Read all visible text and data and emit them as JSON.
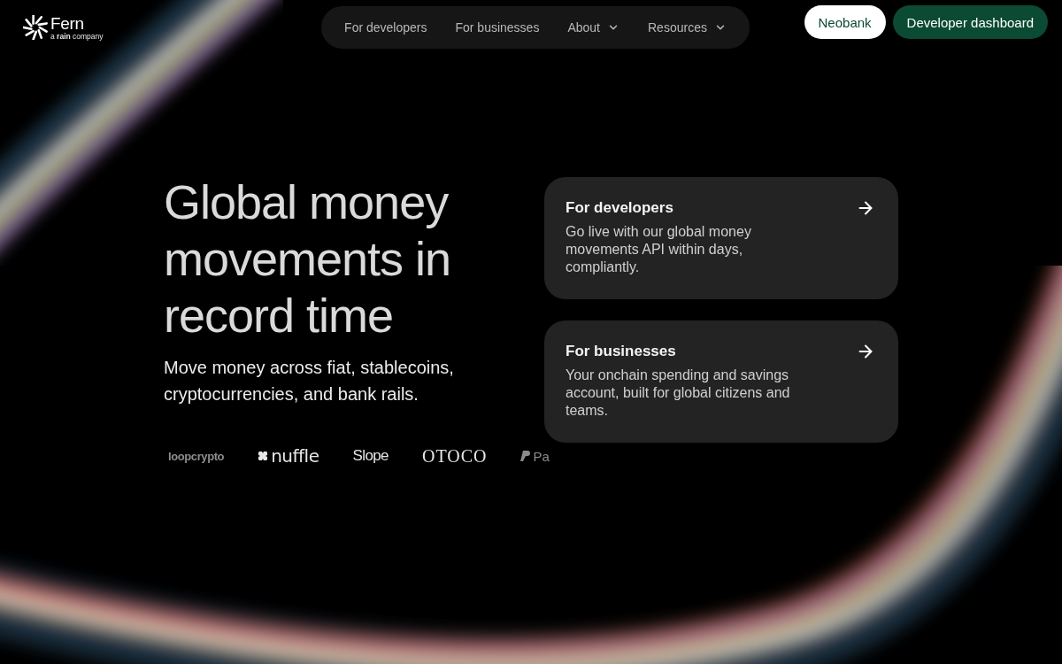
{
  "header": {
    "logo": {
      "name": "Fern",
      "tagline": "a **rain** company"
    },
    "nav": [
      {
        "label": "For developers",
        "kind": "link"
      },
      {
        "label": "For businesses",
        "kind": "link"
      },
      {
        "label": "About",
        "kind": "menu"
      },
      {
        "label": "Resources",
        "kind": "menu"
      }
    ],
    "buttons": [
      {
        "label": "Neobank",
        "kind": "secondary"
      },
      {
        "label": "Developer dashboard",
        "kind": "primary"
      }
    ]
  },
  "hero": {
    "heading": "Global money movements in record time",
    "subtitle": "Move money across fiat, stablecoins, cryptocurrencies, and bank rails.",
    "logos": [
      {
        "name": "loopcrypto",
        "kind": "text"
      },
      {
        "name": "nuffle",
        "kind": "mark"
      },
      {
        "name": "Slope",
        "kind": "text"
      },
      {
        "name": "OTOCO",
        "kind": "text"
      },
      {
        "name": "Pa",
        "kind": "mark"
      }
    ]
  },
  "cards": [
    {
      "title": "For developers",
      "description": "Go live with our global money movements API within days, compliantly."
    },
    {
      "title": "For businesses",
      "description": "Your onchain spending and savings account, built for global citizens and teams."
    }
  ]
}
